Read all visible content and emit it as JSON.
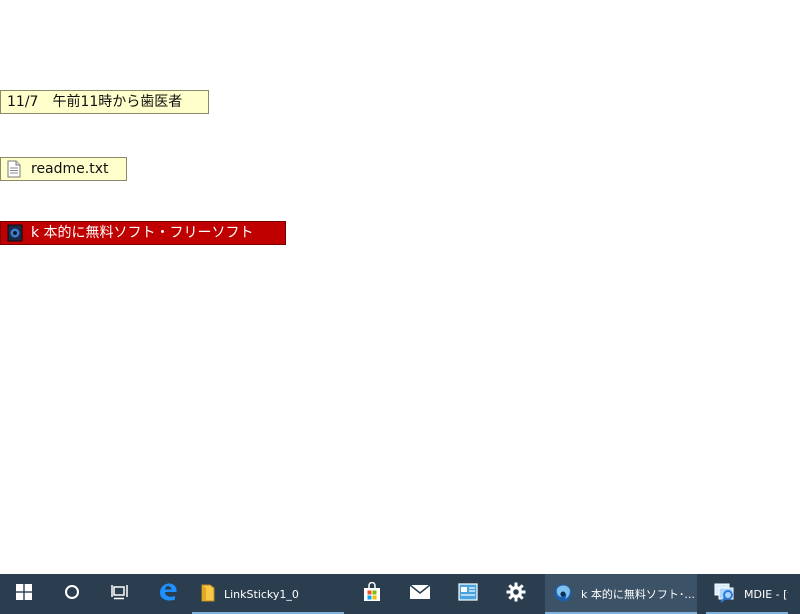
{
  "desktop": {
    "stickies": [
      {
        "label": "11/7　午前11時から歯医者",
        "icon": "none",
        "kind": "memo"
      },
      {
        "label": "readme.txt",
        "icon": "text-file-icon",
        "kind": "file"
      },
      {
        "label": "k 本的に無料ソフト・フリーソフト",
        "icon": "browser-page-icon",
        "kind": "link"
      }
    ]
  },
  "taskbar": {
    "pinned": [
      {
        "name": "start-button",
        "icon": "windows-logo-icon"
      },
      {
        "name": "search-button",
        "icon": "cortana-circle-icon"
      },
      {
        "name": "task-view-button",
        "icon": "task-view-icon"
      },
      {
        "name": "edge-button",
        "icon": "edge-icon"
      }
    ],
    "apps": [
      {
        "label": "LinkSticky1_0",
        "icon": "folder-icon"
      },
      {
        "label": "k 本的に無料ソフト･...",
        "icon": "firefox-icon"
      },
      {
        "label": "MDIE - [t",
        "icon": "mdie-icon"
      }
    ],
    "tray_pinned": [
      {
        "name": "store-button",
        "icon": "store-bag-icon"
      },
      {
        "name": "mail-button",
        "icon": "mail-icon"
      },
      {
        "name": "app-button",
        "icon": "window-app-icon"
      },
      {
        "name": "settings-button",
        "icon": "gear-icon"
      }
    ],
    "colors": {
      "background": "#2b3e50",
      "indicator": "#7fb0de",
      "link_sticky": "#c00000",
      "note_sticky": "#ffffcc"
    }
  }
}
